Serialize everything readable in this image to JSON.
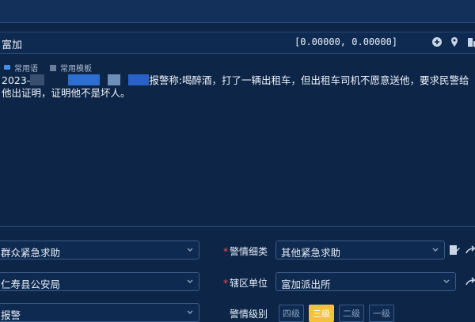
{
  "address": {
    "text": "富加",
    "coords": "[0.00000, 0.00000]"
  },
  "templates": {
    "common_phrases": "常用语",
    "common_templates": "常用模板"
  },
  "description": {
    "prefix": "2023-",
    "body": "报警称:喝醉酒，打了一辆出租车，但出租车司机不愿意送他，要求民警给他出证明，证明他不是坏人。"
  },
  "form": {
    "category": {
      "value": "群众紧急求助"
    },
    "subcategory": {
      "label": "警情细类",
      "value": "其他紧急求助"
    },
    "bureau": {
      "value": "仁寿县公安局"
    },
    "district": {
      "label": "辖区单位",
      "value": "富加派出所"
    },
    "source": {
      "value": "报警"
    },
    "level": {
      "label": "警情级别",
      "options": [
        "四级",
        "三级",
        "二级",
        "一级"
      ],
      "selected": "三级"
    }
  },
  "colors": {
    "background": "#0d2547",
    "accent": "#f4c23a",
    "required": "#ff4d4f"
  }
}
